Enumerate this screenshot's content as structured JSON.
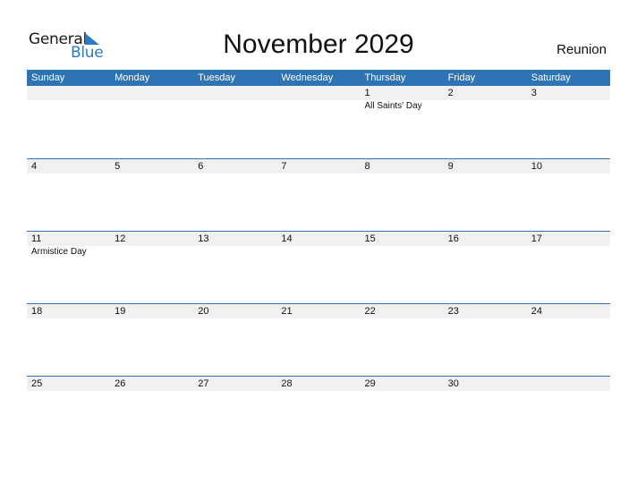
{
  "logo": {
    "general": "General",
    "blue": "Blue"
  },
  "title": "November 2029",
  "country": "Reunion",
  "weekdays": [
    "Sunday",
    "Monday",
    "Tuesday",
    "Wednesday",
    "Thursday",
    "Friday",
    "Saturday"
  ],
  "weeks": [
    {
      "dates": [
        "",
        "",
        "",
        "",
        "1",
        "2",
        "3"
      ],
      "events": [
        "",
        "",
        "",
        "",
        "All Saints' Day",
        "",
        ""
      ]
    },
    {
      "dates": [
        "4",
        "5",
        "6",
        "7",
        "8",
        "9",
        "10"
      ],
      "events": [
        "",
        "",
        "",
        "",
        "",
        "",
        ""
      ]
    },
    {
      "dates": [
        "11",
        "12",
        "13",
        "14",
        "15",
        "16",
        "17"
      ],
      "events": [
        "Armistice Day",
        "",
        "",
        "",
        "",
        "",
        ""
      ]
    },
    {
      "dates": [
        "18",
        "19",
        "20",
        "21",
        "22",
        "23",
        "24"
      ],
      "events": [
        "",
        "",
        "",
        "",
        "",
        "",
        ""
      ]
    },
    {
      "dates": [
        "25",
        "26",
        "27",
        "28",
        "29",
        "30",
        ""
      ],
      "events": [
        "",
        "",
        "",
        "",
        "",
        "",
        ""
      ]
    }
  ]
}
